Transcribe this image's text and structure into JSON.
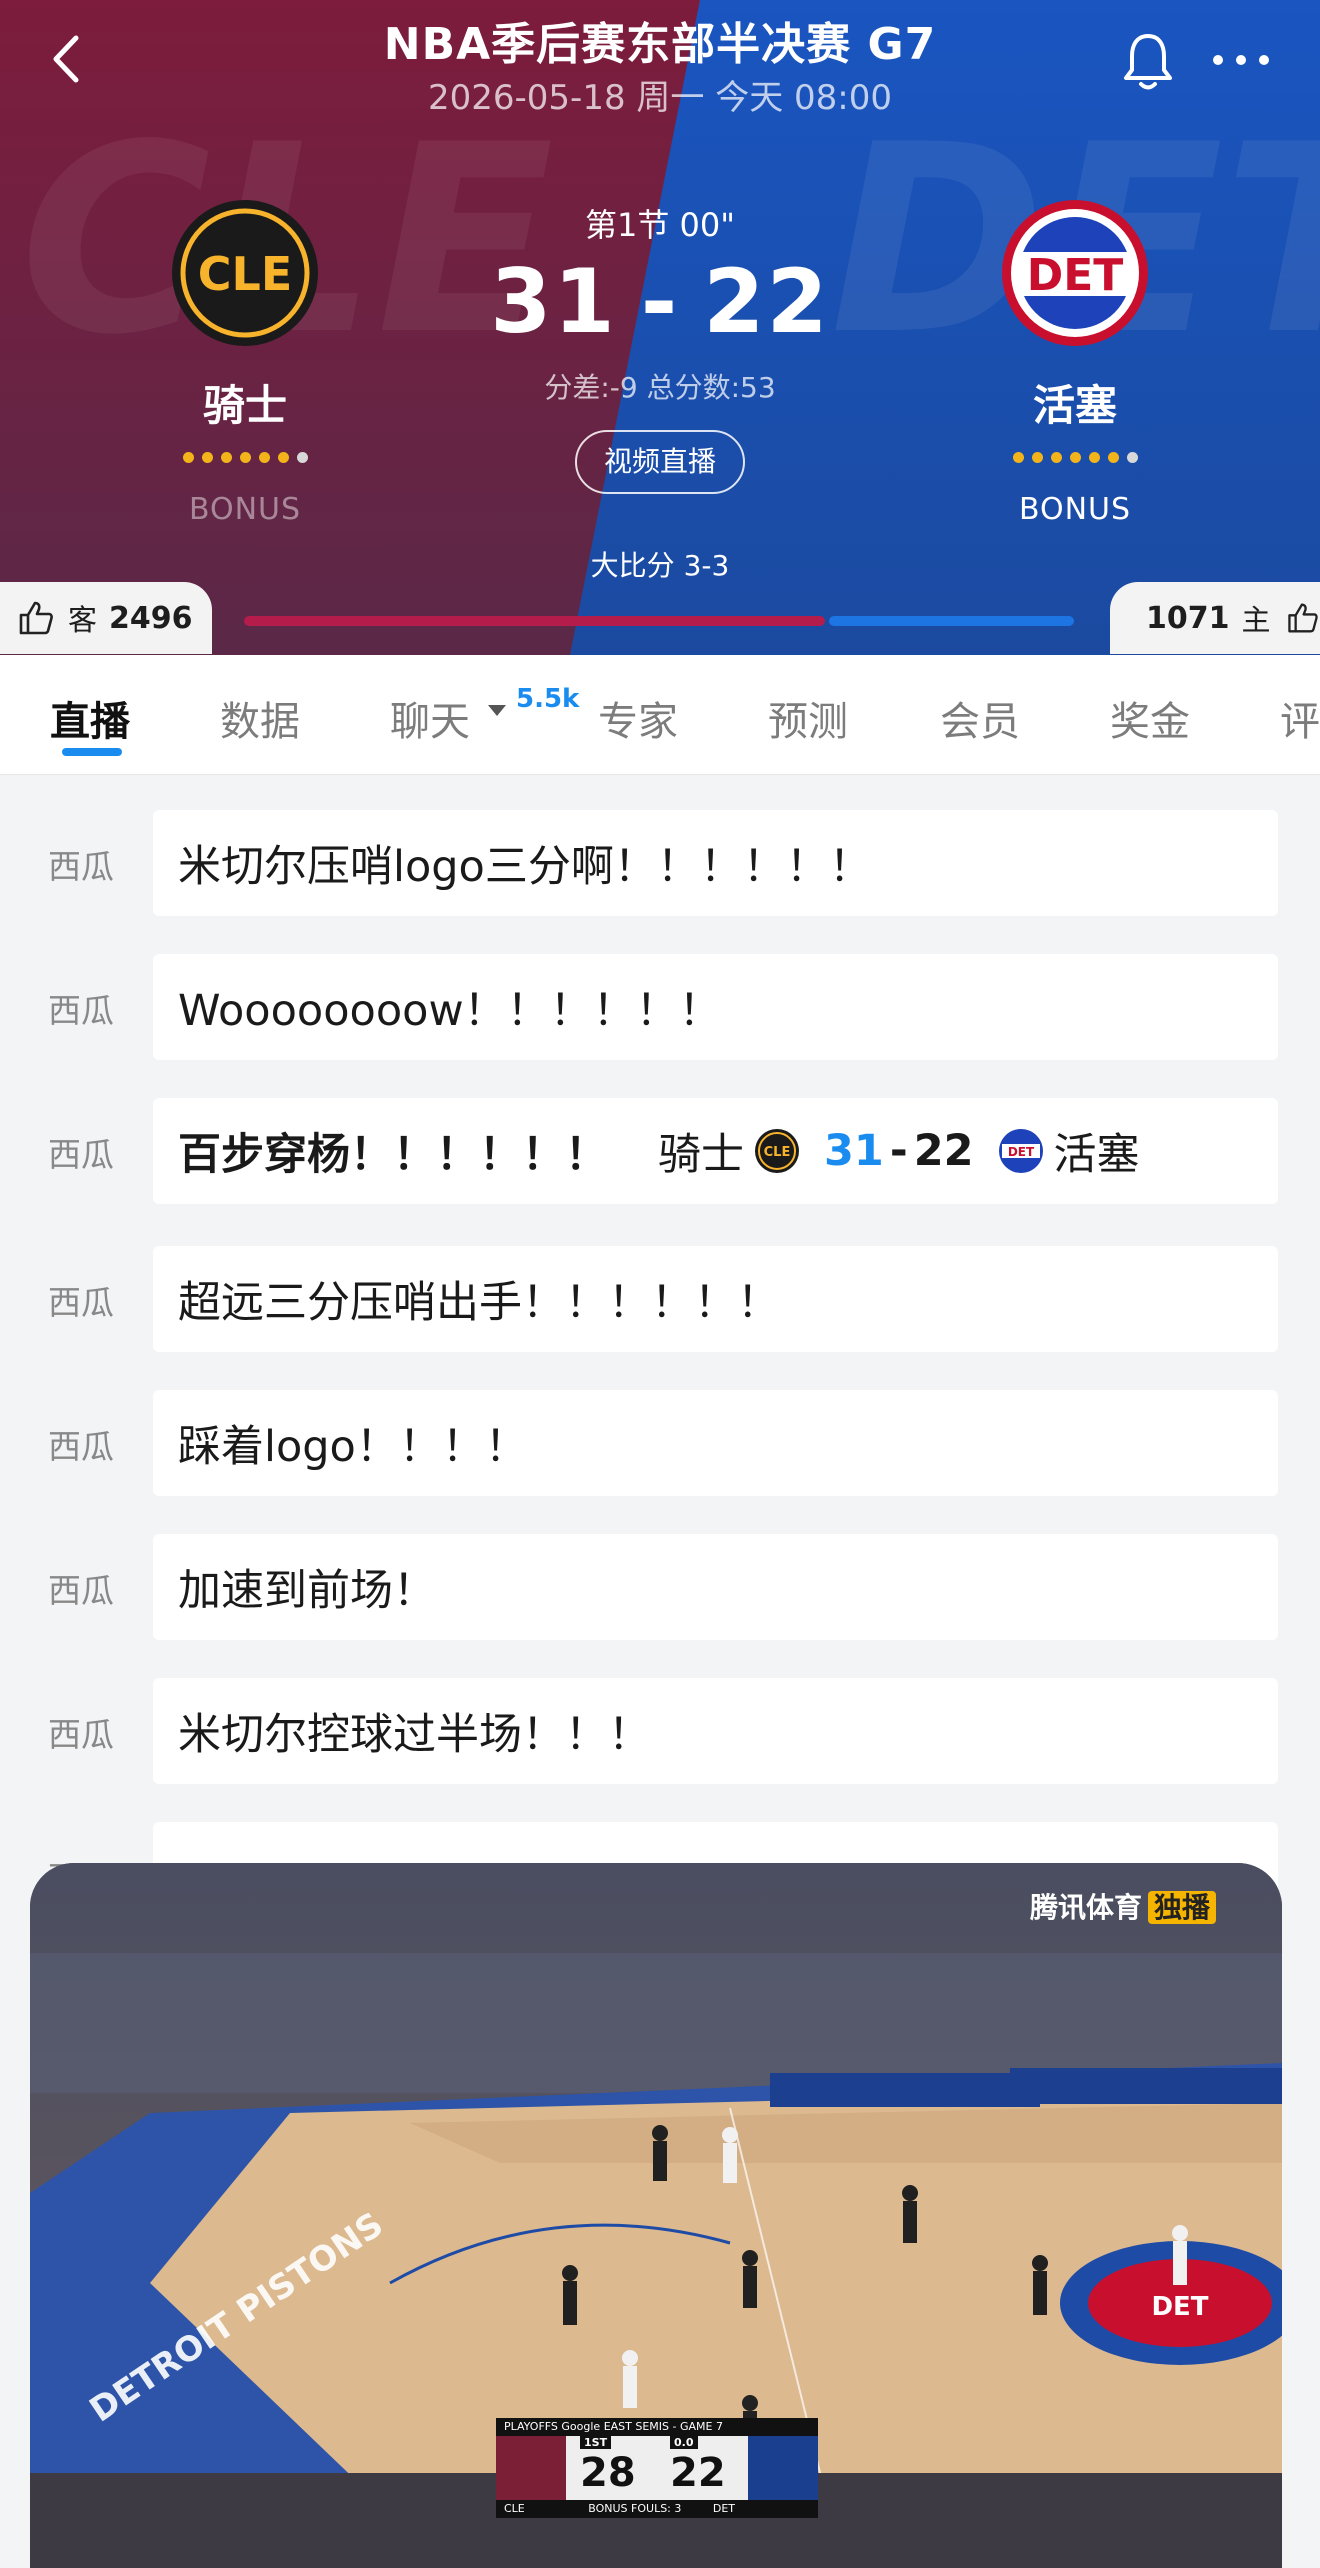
{
  "header": {
    "title": "NBA季后赛东部半决赛 G7",
    "datetime": "2026-05-18 周一 今天 08:00",
    "period": "第1节 00\"",
    "score_home": "31",
    "score_sep": "-",
    "score_away": "22",
    "diff_total": "分差:-9 总分数:53",
    "live_button": "视频直播",
    "series": "大比分 3-3",
    "bg_watermark_left": "CLE",
    "bg_watermark_right": "DET",
    "colors": {
      "left": "#8a1b3f",
      "right": "#1759c4"
    }
  },
  "team_left": {
    "name": "骑士",
    "logo_text": "CLE",
    "bonus": "BONUS",
    "likes_label": "客",
    "likes": "2496"
  },
  "team_right": {
    "name": "活塞",
    "logo_text": "DET",
    "bonus": "BONUS",
    "likes_label": "主",
    "likes": "1071"
  },
  "momentum": {
    "left_fraction": 0.7,
    "right_fraction": 0.3
  },
  "tabs": [
    {
      "label": "直播"
    },
    {
      "label": "数据"
    },
    {
      "label": "聊天"
    },
    {
      "label": "专家"
    },
    {
      "label": "预测"
    },
    {
      "label": "会员"
    },
    {
      "label": "奖金"
    },
    {
      "label": "评"
    }
  ],
  "chat_badge": "5.5k",
  "feed": [
    {
      "user": "西瓜",
      "text": "米切尔压哨logo三分啊！！！！！！"
    },
    {
      "user": "西瓜",
      "text": "Woooooooow！！！！！！"
    },
    {
      "user": "西瓜",
      "text": "百步穿杨！！！！！！",
      "score_line": {
        "home": "骑士",
        "home_score": "31",
        "sep": "-",
        "away_score": "22",
        "away": "活塞"
      }
    },
    {
      "user": "西瓜",
      "text": "超远三分压哨出手！！！！！！"
    },
    {
      "user": "西瓜",
      "text": "踩着logo！！！！"
    },
    {
      "user": "西瓜",
      "text": "加速到前场！"
    },
    {
      "user": "西瓜",
      "text": "米切尔控球过半场！！！"
    },
    {
      "user": "西瓜",
      "text": ""
    }
  ],
  "video": {
    "watermark": "腾讯体育",
    "watermark_tag": "独播",
    "bug": {
      "header": "PLAYOFFS  Google   EAST SEMIS - GAME 7",
      "period": "1ST",
      "clock": "0.0",
      "left_score": "28",
      "right_score": "22",
      "left_team": "CLE",
      "right_team": "DET",
      "foot": "BONUS  FOULS: 3"
    },
    "court_text": "DETROIT PISTONS"
  }
}
